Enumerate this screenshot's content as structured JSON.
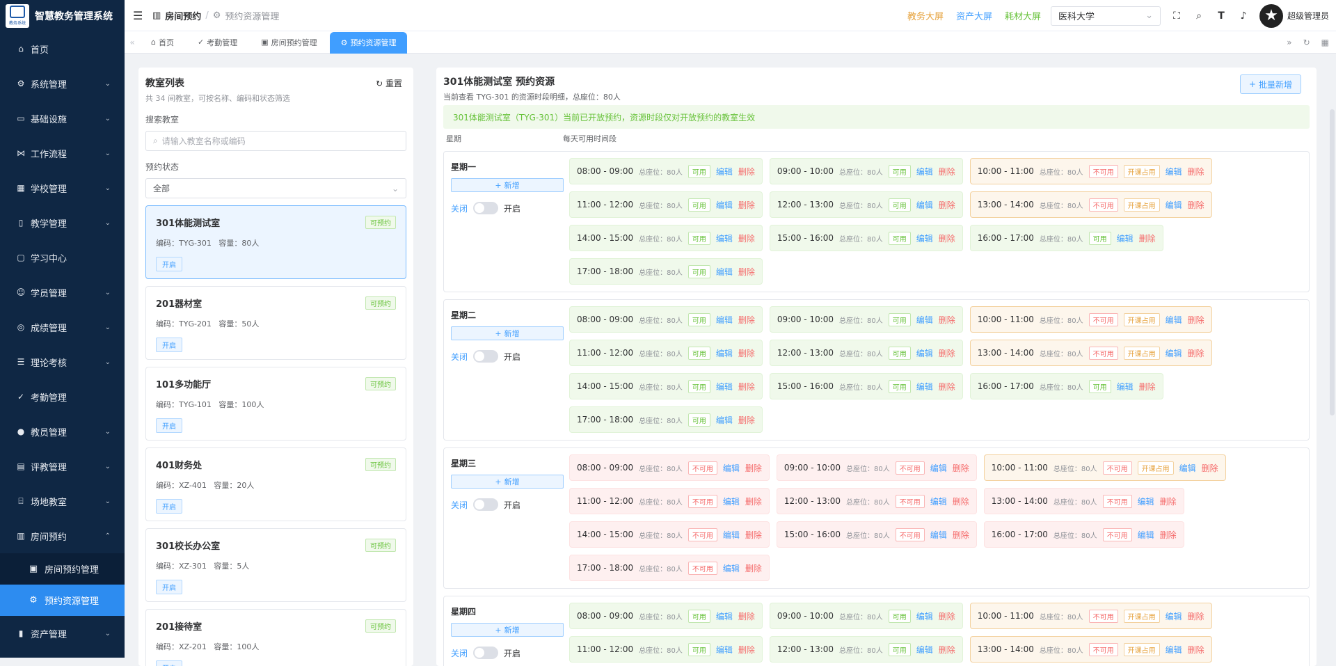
{
  "app": {
    "title": "智慧教务管理系统",
    "logo_caption": "教务系统"
  },
  "sidebar": {
    "items": [
      {
        "label": "首页",
        "icon": "home-icon",
        "glyph": "⌂",
        "chev": false
      },
      {
        "label": "系统管理",
        "icon": "gear-icon",
        "glyph": "⚙",
        "chev": true
      },
      {
        "label": "基础设施",
        "icon": "monitor-icon",
        "glyph": "▭",
        "chev": true
      },
      {
        "label": "工作流程",
        "icon": "workflow-icon",
        "glyph": "⋈",
        "chev": true
      },
      {
        "label": "学校管理",
        "icon": "school-icon",
        "glyph": "▦",
        "chev": true
      },
      {
        "label": "教学管理",
        "icon": "book-icon",
        "glyph": "▯",
        "chev": true
      },
      {
        "label": "学习中心",
        "icon": "reader-icon",
        "glyph": "▢",
        "chev": false
      },
      {
        "label": "学员管理",
        "icon": "user-icon",
        "glyph": "☺",
        "chev": true
      },
      {
        "label": "成绩管理",
        "icon": "medal-icon",
        "glyph": "◎",
        "chev": true
      },
      {
        "label": "理论考核",
        "icon": "exam-icon",
        "glyph": "☰",
        "chev": true
      },
      {
        "label": "考勤管理",
        "icon": "check-icon",
        "glyph": "✓",
        "chev": false
      },
      {
        "label": "教员管理",
        "icon": "teacher-icon",
        "glyph": "●",
        "chev": true
      },
      {
        "label": "评教管理",
        "icon": "eval-icon",
        "glyph": "▤",
        "chev": true
      },
      {
        "label": "场地教室",
        "icon": "venue-icon",
        "glyph": "⌸",
        "chev": true
      },
      {
        "label": "房间预约",
        "icon": "room-icon",
        "glyph": "▥",
        "chev": true,
        "open": true
      }
    ],
    "sub": [
      {
        "label": "房间预约管理",
        "icon": "calendar-icon",
        "glyph": "▣"
      },
      {
        "label": "预约资源管理",
        "icon": "settings-icon",
        "glyph": "⚙",
        "active": true
      }
    ],
    "after": [
      {
        "label": "资产管理",
        "icon": "asset-icon",
        "glyph": "▮",
        "chev": true
      }
    ]
  },
  "header": {
    "crumb_current": "房间预约",
    "crumb_sep": "/",
    "crumb_last": "预约资源管理",
    "links": [
      {
        "label": "教务大屏",
        "color": "#e6a23c"
      },
      {
        "label": "资产大屏",
        "color": "#409eff"
      },
      {
        "label": "耗材大屏",
        "color": "#67c23a"
      }
    ],
    "school": "医科大学",
    "user": "超级管理员"
  },
  "tabs": [
    {
      "label": "首页",
      "glyph": "⌂"
    },
    {
      "label": "考勤管理",
      "glyph": "✓"
    },
    {
      "label": "房间预约管理",
      "glyph": "▣"
    },
    {
      "label": "预约资源管理",
      "glyph": "⚙",
      "active": true
    }
  ],
  "left": {
    "title": "教室列表",
    "reset": "重置",
    "subtitle": "共 34 间教室，可按名称、编码和状态筛选",
    "search_label": "搜索教室",
    "search_placeholder": "请输入教室名称或编码",
    "status_label": "预约状态",
    "status_value": "全部",
    "rooms": [
      {
        "name": "301体能测试室",
        "info": "编码：TYG-301   容量：80人",
        "badge": "可预约",
        "open": "开启",
        "sel": true
      },
      {
        "name": "201器材室",
        "info": "编码：TYG-201   容量：50人",
        "badge": "可预约",
        "open": "开启"
      },
      {
        "name": "101多功能厅",
        "info": "编码：TYG-101   容量：100人",
        "badge": "可预约",
        "open": "开启"
      },
      {
        "name": "401财务处",
        "info": "编码：XZ-401   容量：20人",
        "badge": "可预约",
        "open": "开启"
      },
      {
        "name": "301校长办公室",
        "info": "编码：XZ-301   容量：5人",
        "badge": "可预约",
        "open": "开启"
      },
      {
        "name": "201接待室",
        "info": "编码：XZ-201   容量：100人",
        "badge": "可预约",
        "open": "开启"
      }
    ]
  },
  "right": {
    "title": "301体能测试室 预约资源",
    "subtitle": "当前查看 TYG-301 的资源时段明细，总座位：80人",
    "batch": "批量新增",
    "alert": "301体能测试室（TYG-301）当前已开放预约，资源时段仅对开放预约的教室生效",
    "col_day": "星期",
    "col_slots": "每天可用时间段",
    "add": "新增",
    "sw_off": "关闭",
    "sw_on": "开启",
    "cap": "总座位：80人",
    "edit": "编辑",
    "del": "删除",
    "tag_ok": "可用",
    "tag_no": "不可用",
    "tag_occ": "开课占用",
    "days": [
      {
        "name": "星期一",
        "slots": [
          [
            "08:00 - 09:00",
            "ok"
          ],
          [
            "09:00 - 10:00",
            "ok"
          ],
          [
            "10:00 - 11:00",
            "occ"
          ],
          [
            "11:00 - 12:00",
            "ok"
          ],
          [
            "12:00 - 13:00",
            "ok"
          ],
          [
            "13:00 - 14:00",
            "occ"
          ],
          [
            "14:00 - 15:00",
            "ok"
          ],
          [
            "15:00 - 16:00",
            "ok"
          ],
          [
            "16:00 - 17:00",
            "ok"
          ],
          [
            "17:00 - 18:00",
            "ok"
          ]
        ]
      },
      {
        "name": "星期二",
        "slots": [
          [
            "08:00 - 09:00",
            "ok"
          ],
          [
            "09:00 - 10:00",
            "ok"
          ],
          [
            "10:00 - 11:00",
            "occ"
          ],
          [
            "11:00 - 12:00",
            "ok"
          ],
          [
            "12:00 - 13:00",
            "ok"
          ],
          [
            "13:00 - 14:00",
            "occ"
          ],
          [
            "14:00 - 15:00",
            "ok"
          ],
          [
            "15:00 - 16:00",
            "ok"
          ],
          [
            "16:00 - 17:00",
            "ok"
          ],
          [
            "17:00 - 18:00",
            "ok"
          ]
        ]
      },
      {
        "name": "星期三",
        "slots": [
          [
            "08:00 - 09:00",
            "no"
          ],
          [
            "09:00 - 10:00",
            "no"
          ],
          [
            "10:00 - 11:00",
            "occ"
          ],
          [
            "11:00 - 12:00",
            "no"
          ],
          [
            "12:00 - 13:00",
            "no"
          ],
          [
            "13:00 - 14:00",
            "no"
          ],
          [
            "14:00 - 15:00",
            "no"
          ],
          [
            "15:00 - 16:00",
            "no"
          ],
          [
            "16:00 - 17:00",
            "no"
          ],
          [
            "17:00 - 18:00",
            "no"
          ]
        ]
      },
      {
        "name": "星期四",
        "slots": [
          [
            "08:00 - 09:00",
            "ok"
          ],
          [
            "09:00 - 10:00",
            "ok"
          ],
          [
            "10:00 - 11:00",
            "occ"
          ],
          [
            "11:00 - 12:00",
            "ok"
          ],
          [
            "12:00 - 13:00",
            "ok"
          ],
          [
            "13:00 - 14:00",
            "occ"
          ]
        ]
      }
    ]
  }
}
